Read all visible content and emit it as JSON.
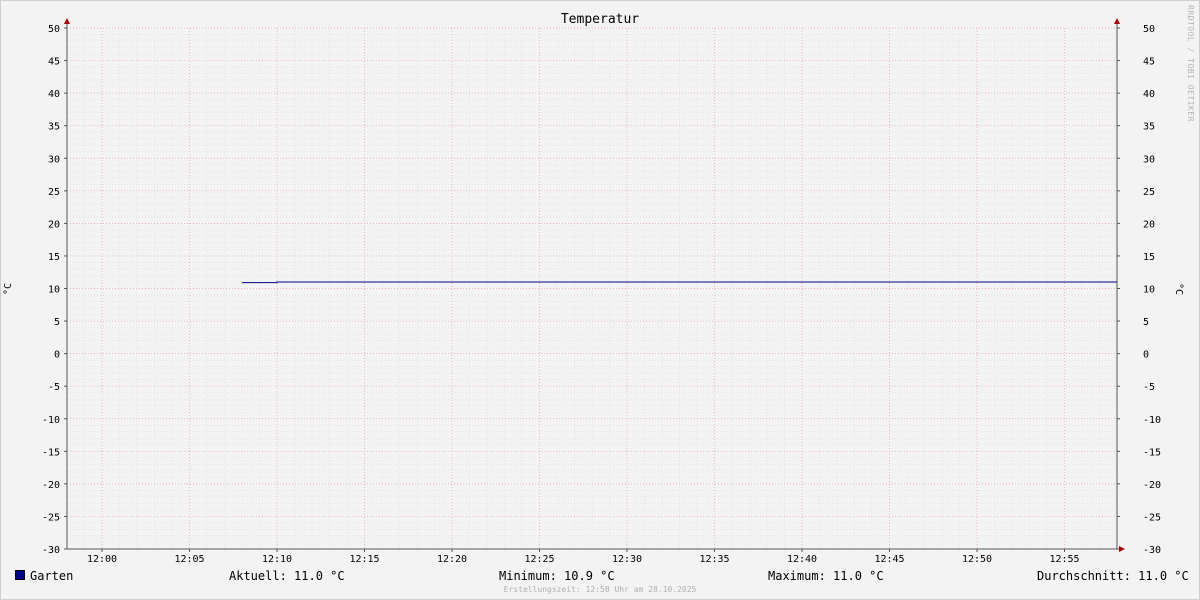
{
  "chart_data": {
    "type": "line",
    "title": "Temperatur",
    "ylabel": "°C",
    "ylabel_right": "°C",
    "ylim": [
      -30,
      50
    ],
    "ytick_step": 5,
    "ytick_minor": 1,
    "xlim": [
      "11:58",
      "12:58"
    ],
    "xticks": [
      "12:00",
      "12:05",
      "12:10",
      "12:15",
      "12:20",
      "12:25",
      "12:30",
      "12:35",
      "12:40",
      "12:45",
      "12:50",
      "12:55"
    ],
    "x_minor_minutes": 1,
    "grid": true,
    "series": [
      {
        "name": "Garten",
        "color": "#00008b",
        "points": [
          {
            "x": "12:08",
            "y": 10.9
          },
          {
            "x": "12:10",
            "y": 10.9
          },
          {
            "x": "12:10",
            "y": 11.0
          },
          {
            "x": "12:58",
            "y": 11.0
          }
        ]
      }
    ]
  },
  "legend": {
    "label": "Garten",
    "color": "#00008b"
  },
  "stats": {
    "current": "Aktuell: 11.0 °C",
    "minimum": "Minimum: 10.9 °C",
    "maximum": "Maximum: 11.0 °C",
    "average": "Durchschnitt: 11.0 °C"
  },
  "credit": "Erstellungszeit: 12:58 Uhr am 28.10.2025",
  "watermark": "RRDTOOL / TOBI OETIKER"
}
